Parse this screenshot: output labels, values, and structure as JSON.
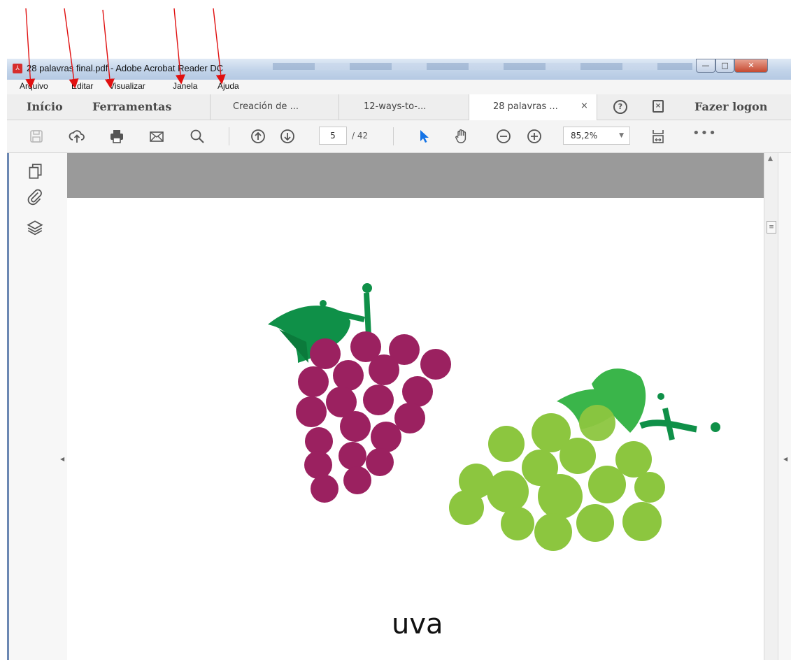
{
  "window": {
    "title": "28 palavras final.pdf - Adobe Acrobat Reader DC"
  },
  "window_controls": {
    "minimize": "—",
    "maximize": "□",
    "close": "✕"
  },
  "menu": [
    "Arquivo",
    "Editar",
    "Visualizar",
    "Janela",
    "Ajuda"
  ],
  "tabs": {
    "home": "Início",
    "tools": "Ferramentas",
    "documents": [
      "Creación de ...",
      "12-ways-to-...",
      "28 palavras ..."
    ],
    "active_index": 2,
    "close_glyph": "×",
    "help_glyph": "?",
    "panel_glyph": "×",
    "login": "Fazer logon"
  },
  "toolbar": {
    "page_current": "5",
    "page_total": "/ 42",
    "zoom": "85,2%",
    "more": "•••"
  },
  "page": {
    "word": "uva"
  },
  "colors": {
    "purple_grape": "#9b2160",
    "green_grape": "#8cc63f",
    "leaf_dark": "#0f9048",
    "leaf_light": "#3ab54a",
    "annotation_arrow": "#e01010"
  },
  "icons": [
    "save-icon",
    "upload-icon",
    "print-icon",
    "email-icon",
    "search-icon",
    "page-up-icon",
    "page-down-icon",
    "select-arrow-icon",
    "hand-icon",
    "zoom-out-icon",
    "zoom-in-icon",
    "fit-page-icon",
    "pages-icon",
    "attachment-icon",
    "layers-icon"
  ]
}
